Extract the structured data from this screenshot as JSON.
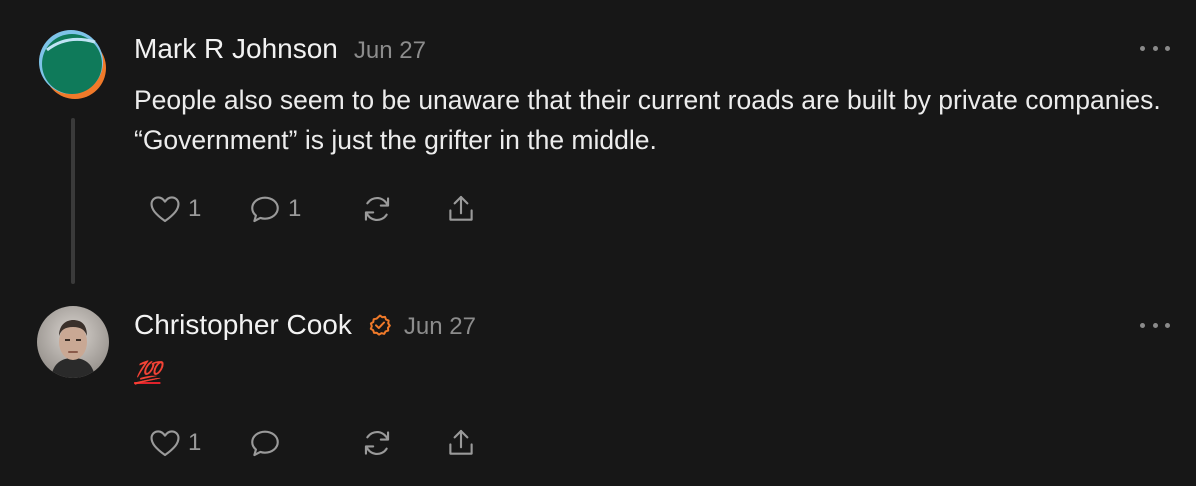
{
  "comments": [
    {
      "author": "Mark R Johnson",
      "date": "Jun 27",
      "verified": false,
      "text": "People also seem to be unaware that their current roads are built by private companies. “Government” is just the grifter in the middle.",
      "likes": "1",
      "replies": "1",
      "avatar_icon": "colorful-circle-avatar",
      "avatar_colors": [
        "#0f7a5a",
        "#f07a2a",
        "#7ec3e8"
      ]
    },
    {
      "author": "Christopher Cook",
      "date": "Jun 27",
      "verified": true,
      "badge_color": "#f07a2a",
      "text": "💯",
      "likes": "1",
      "replies": "",
      "avatar_icon": "person-photo-avatar"
    }
  ],
  "icons": {
    "like": "heart-icon",
    "comment": "speech-bubble-icon",
    "restack": "restack-arrows-icon",
    "share": "share-upload-icon",
    "more": "more-options-icon"
  },
  "colors": {
    "background": "#171717",
    "text": "#ececec",
    "muted": "#8c8c8c",
    "accent": "#f07a2a"
  }
}
